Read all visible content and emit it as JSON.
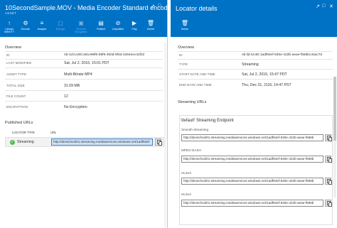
{
  "left": {
    "title": "10SecondSample.MOV - Media Encoder Standard encoded",
    "subtitle": "ASSET",
    "toolbar": [
      {
        "icon": "upload-icon",
        "label": "Upload WebVTT",
        "enabled": true
      },
      {
        "icon": "encode-icon",
        "label": "Encode",
        "enabled": true
      },
      {
        "icon": "analyze-icon",
        "label": "Analyze",
        "enabled": true
      },
      {
        "icon": "encrypt-icon",
        "label": "Encrypt",
        "enabled": false
      },
      {
        "icon": "remove-encryption-icon",
        "label": "Remove Encryption",
        "enabled": false
      },
      {
        "icon": "publish-icon",
        "label": "Publish",
        "enabled": true
      },
      {
        "icon": "unpublish-icon",
        "label": "Unpublish",
        "enabled": true
      },
      {
        "icon": "play-icon",
        "label": "Play",
        "enabled": true
      },
      {
        "icon": "delete-icon",
        "label": "Delete",
        "enabled": true
      }
    ],
    "overview_title": "Overview",
    "fields": [
      {
        "label": "ID",
        "value": "nb:cid:UUID:a61e98f6-86f9-460d-9f4d-2264eec42f22"
      },
      {
        "label": "LAST MODIFIED",
        "value": "Sat, Jul 2, 2016, 15:01 PDT"
      },
      {
        "label": "ASSET TYPE",
        "value": "Multi-Bitrate MP4"
      },
      {
        "label": "TOTAL SIZE",
        "value": "31.69 MB"
      },
      {
        "label": "FILE COUNT",
        "value": "12"
      },
      {
        "label": "ENCRYPTION",
        "value": "No Encryption"
      }
    ],
    "published_title": "Published URLs",
    "table_headers": {
      "type": "LOCATOR TYPE",
      "url": "URL"
    },
    "published_row": {
      "type": "Streaming",
      "url": "http://devschool01.streaming.mediaservices.windows.net/1adf84ef"
    }
  },
  "right": {
    "title": "Locator details",
    "toolbar": [
      {
        "icon": "delete-icon",
        "label": "Delete",
        "enabled": true
      }
    ],
    "overview_title": "Overview",
    "fields": [
      {
        "label": "ID",
        "value": "nb:lid:UUID:1adf84ef-530e-422b-aeae-f566bc44ac7d"
      },
      {
        "label": "TYPE",
        "value": "Streaming"
      },
      {
        "label": "START DATE AND TIME",
        "value": "Sat, Jul 2, 2016, 15:47 PDT"
      },
      {
        "label": "END DATE AND TIME",
        "value": "Thu, Dec 31, 2116, 14:47 PST"
      }
    ],
    "streaming_title": "Streaming URLs",
    "endpoint_title": "'default' Streaming Endpoint",
    "urls": [
      {
        "label": "Smooth Streaming",
        "value": "http://devschool01.streaming.mediaservices.windows.net/1adf84ef-530e-422b-aeae-f566b"
      },
      {
        "label": "MPEG-DASH",
        "value": "http://devschool01.streaming.mediaservices.windows.net/1adf84ef-530e-422b-aeae-f566b"
      },
      {
        "label": "HLSv3",
        "value": "http://devschool01.streaming.mediaservices.windows.net/1adf84ef-530e-422b-aeae-f566b"
      },
      {
        "label": "HLSv4",
        "value": "http://devschool01.streaming.mediaservices.windows.net/1adf84ef-530e-422b-aeae-f566b"
      }
    ]
  },
  "colors": {
    "header": "#0072c6",
    "disabled": "#7fb0dc",
    "success": "#5cb85c"
  }
}
